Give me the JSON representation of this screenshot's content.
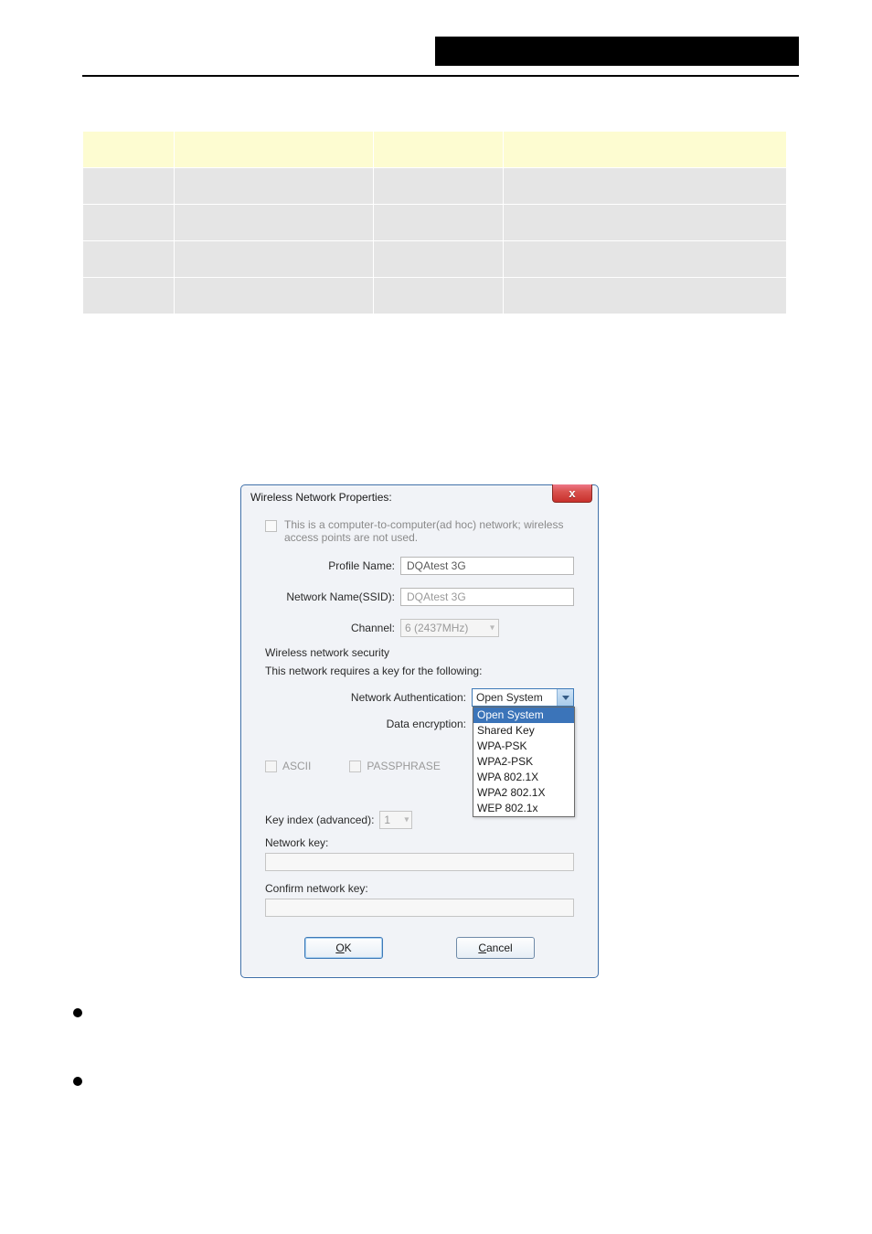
{
  "table": {
    "headers": [
      "",
      "",
      "",
      ""
    ],
    "rows": [
      [
        "",
        "",
        "",
        ""
      ],
      [
        "",
        "",
        "",
        ""
      ],
      [
        "",
        "",
        "",
        ""
      ],
      [
        "",
        "",
        "",
        ""
      ]
    ]
  },
  "dialog": {
    "title": "Wireless Network Properties:",
    "close_char": "x",
    "adhoc_text": "This is a computer-to-computer(ad hoc) network; wireless access points are not used.",
    "profile_name_label": "Profile Name:",
    "profile_name_value": "DQAtest 3G",
    "ssid_label": "Network Name(SSID):",
    "ssid_value": "DQAtest 3G",
    "channel_label": "Channel:",
    "channel_value": "6 (2437MHz)",
    "sec_heading": "Wireless network security",
    "sec_sub": "This network requires a key for the following:",
    "auth_label": "Network Authentication:",
    "auth_value": "Open System",
    "auth_options": [
      "Open System",
      "Shared Key",
      "WPA-PSK",
      "WPA2-PSK",
      "WPA 802.1X",
      "WPA2 802.1X",
      "WEP 802.1x"
    ],
    "enc_label": "Data encryption:",
    "ascii_label": "ASCII",
    "passphrase_label": "PASSPHRASE",
    "keyindex_label": "Key index (advanced):",
    "keyindex_value": "1",
    "networkkey_label": "Network key:",
    "confirmkey_label": "Confirm network key:",
    "ok_label": "OK",
    "ok_mnemonic": "O",
    "cancel_label": "Cancel",
    "cancel_mnemonic": "C"
  }
}
